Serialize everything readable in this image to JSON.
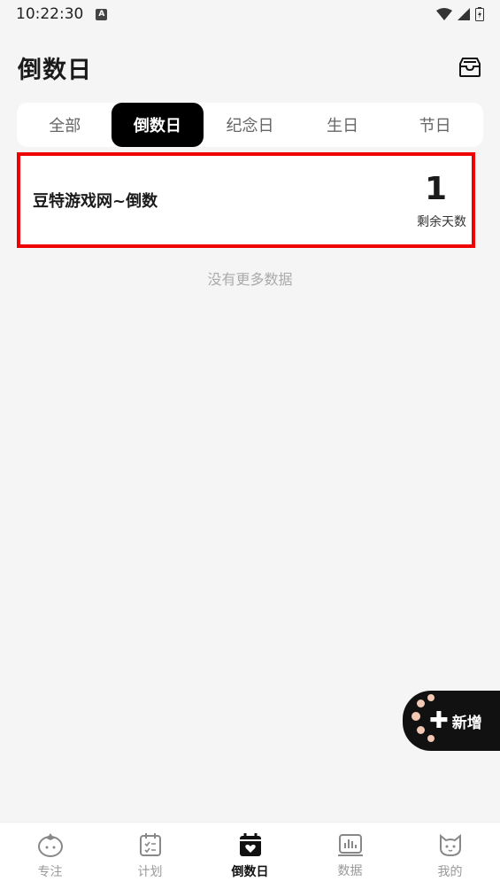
{
  "status_bar": {
    "time": "10:22:30",
    "app_badge": "A"
  },
  "header": {
    "title": "倒数日"
  },
  "tabs": [
    {
      "label": "全部",
      "active": false
    },
    {
      "label": "倒数日",
      "active": true
    },
    {
      "label": "纪念日",
      "active": false
    },
    {
      "label": "生日",
      "active": false
    },
    {
      "label": "节日",
      "active": false
    }
  ],
  "events": [
    {
      "title": "豆特游戏网~倒数",
      "days": "1",
      "days_label": "剩余天数"
    }
  ],
  "list_footer": "没有更多数据",
  "add_button": {
    "label": "新增",
    "icon": "plus-icon"
  },
  "bottom_nav": [
    {
      "label": "专注",
      "icon": "tomato-icon",
      "active": false
    },
    {
      "label": "计划",
      "icon": "calendar-checklist-icon",
      "active": false
    },
    {
      "label": "倒数日",
      "icon": "calendar-heart-icon",
      "active": true
    },
    {
      "label": "数据",
      "icon": "bar-chart-icon",
      "active": false
    },
    {
      "label": "我的",
      "icon": "cat-icon",
      "active": false
    }
  ],
  "colors": {
    "accent": "#000000",
    "highlight_border": "#ee0000",
    "inactive": "#999999"
  }
}
